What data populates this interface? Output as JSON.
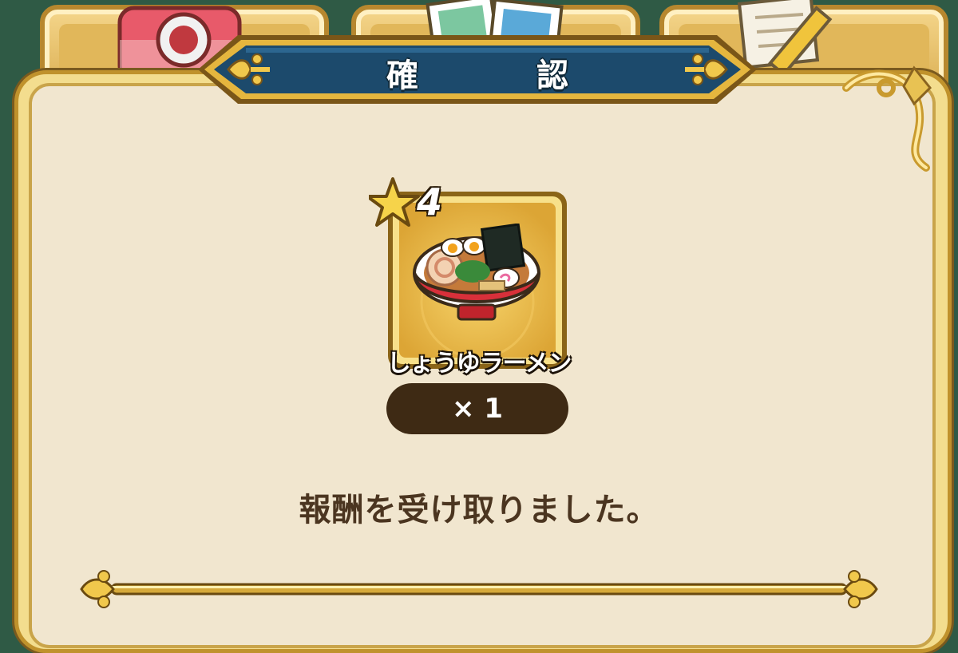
{
  "dialog": {
    "title": "確　認",
    "message": "報酬を受け取りました。"
  },
  "reward": {
    "rarity_stars": "4",
    "item_name": "しょうゆラーメン",
    "quantity_label": "× 1"
  },
  "background_tabs": [
    {
      "icon": "camera-icon"
    },
    {
      "icon": "photos-icon"
    },
    {
      "icon": "notepad-pencil-icon"
    }
  ],
  "colors": {
    "banner": "#1c4a6c",
    "gold": "#e0b23c",
    "panel": "#f1e6cf",
    "text_brown": "#4b3520"
  }
}
